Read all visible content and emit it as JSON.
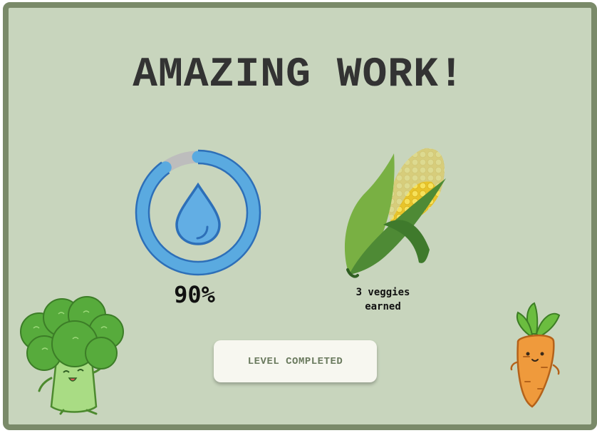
{
  "title": "AMAZING WORK!",
  "water": {
    "percent_label": "90%",
    "progress": 0.9,
    "icon": "water-drop-icon"
  },
  "reward": {
    "label_line1": "3 veggies",
    "label_line2": "earned",
    "icon": "corn-icon"
  },
  "button": {
    "label": "LEVEL COMPLETED"
  },
  "decorations": [
    "broccoli-character",
    "carrot-character"
  ],
  "colors": {
    "background": "#c8d5bd",
    "border": "#7a8a69",
    "ring": "#5aaae0",
    "ring_track": "#bfbfbf",
    "title": "#333333"
  }
}
